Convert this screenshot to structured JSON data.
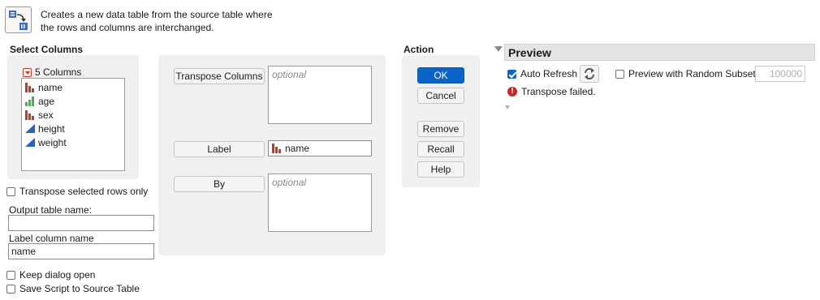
{
  "header": {
    "description_line1": "Creates a new data table from the source table where",
    "description_line2": "the rows and columns are interchanged."
  },
  "select_columns": {
    "title": "Select Columns",
    "count_label": "5 Columns",
    "columns": [
      {
        "name": "name",
        "type": "nominal"
      },
      {
        "name": "age",
        "type": "ordinal"
      },
      {
        "name": "sex",
        "type": "nominal"
      },
      {
        "name": "height",
        "type": "continuous"
      },
      {
        "name": "weight",
        "type": "continuous"
      }
    ]
  },
  "options": {
    "transpose_selected_rows_only": "Transpose selected rows only",
    "output_table_name_label": "Output table name:",
    "output_table_name_value": "",
    "label_column_name_label": "Label column name",
    "label_column_name_value": "name",
    "keep_dialog_open": "Keep dialog open",
    "save_script": "Save Script to Source Table"
  },
  "roles": {
    "transpose_columns_label": "Transpose Columns",
    "transpose_columns_placeholder": "optional",
    "label_label": "Label",
    "label_value": "name",
    "by_label": "By",
    "by_placeholder": "optional"
  },
  "action": {
    "title": "Action",
    "ok": "OK",
    "cancel": "Cancel",
    "remove": "Remove",
    "recall": "Recall",
    "help": "Help"
  },
  "preview": {
    "title": "Preview",
    "auto_refresh": "Auto Refresh",
    "auto_refresh_checked": true,
    "random_subset_label": "Preview with Random Subset",
    "random_subset_value": "100000",
    "error_message": "Transpose failed."
  },
  "colors": {
    "accent": "#0a64c8",
    "nominal_icon": "#c0392b",
    "ordinal_icon": "#4caf50",
    "continuous_icon": "#2f5fb8",
    "error": "#c62828"
  }
}
